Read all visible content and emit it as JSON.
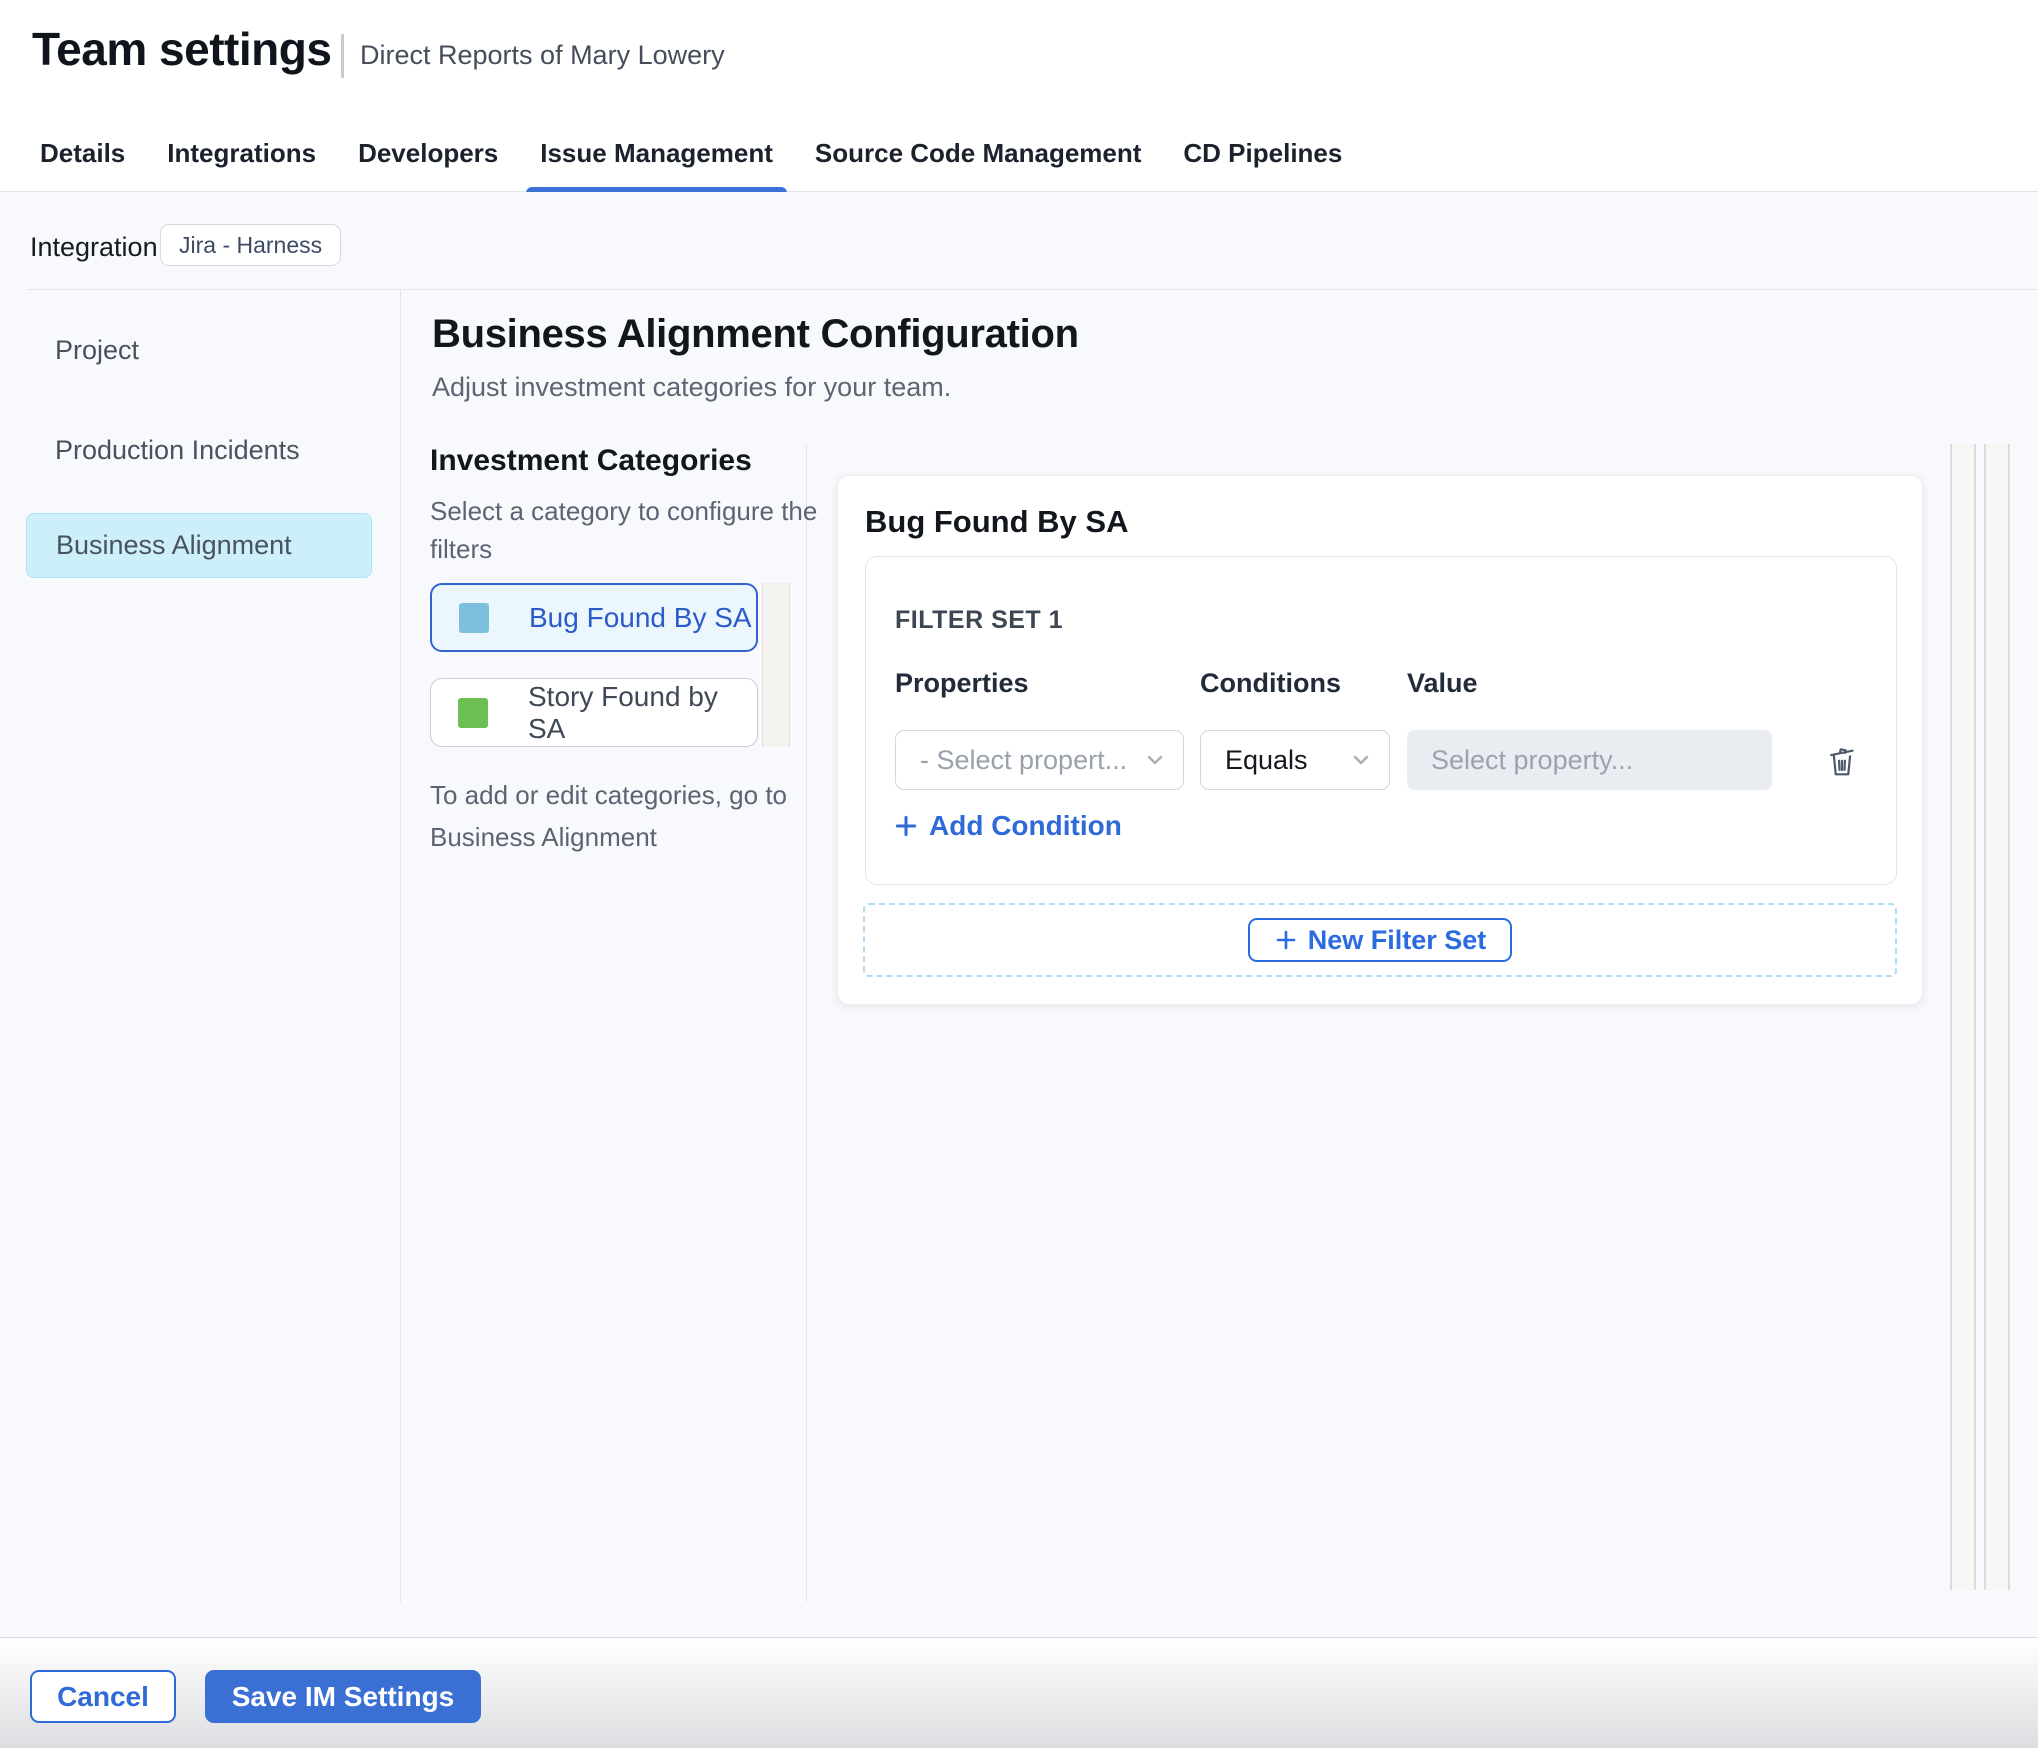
{
  "header": {
    "title": "Team settings",
    "subtitle": "Direct Reports of Mary Lowery"
  },
  "tabs": [
    {
      "label": "Details",
      "active": false
    },
    {
      "label": "Integrations",
      "active": false
    },
    {
      "label": "Developers",
      "active": false
    },
    {
      "label": "Issue Management",
      "active": true
    },
    {
      "label": "Source Code Management",
      "active": false
    },
    {
      "label": "CD Pipelines",
      "active": false
    }
  ],
  "integration": {
    "label": "Integration:",
    "chip": "Jira - Harness"
  },
  "sidebar": {
    "items": [
      {
        "label": "Project",
        "selected": false
      },
      {
        "label": "Production Incidents",
        "selected": false
      },
      {
        "label": "Business Alignment",
        "selected": true
      }
    ]
  },
  "main": {
    "title": "Business Alignment Configuration",
    "subtitle": "Adjust investment categories for your team.",
    "categories": {
      "title": "Investment Categories",
      "helper_line1": "Select a category to configure the",
      "helper_line2": "filters",
      "items": [
        {
          "label": "Bug Found By SA",
          "swatch_color": "#7cc0dd",
          "selected": true
        },
        {
          "label": "Story Found by SA",
          "swatch_color": "#6cc052",
          "selected": false
        }
      ],
      "note_line1": "To add or edit categories, go to",
      "note_line2": "Business Alignment"
    },
    "panel": {
      "title": "Bug Found By SA",
      "filter_set": {
        "title": "FILTER SET 1",
        "properties_label": "Properties",
        "conditions_label": "Conditions",
        "value_label": "Value",
        "property_selected": "- Select propert...",
        "condition_selected": "Equals",
        "value_placeholder": "Select property...",
        "add_condition_label": "Add Condition"
      },
      "new_filter_set_label": "New Filter Set"
    }
  },
  "footer": {
    "cancel_label": "Cancel",
    "save_label": "Save IM Settings"
  },
  "icons": {
    "select_chevron": "chevron-down-icon",
    "delete_condition": "trash-icon",
    "add": "plus-icon"
  },
  "colors": {
    "accent_blue": "#3b70d6",
    "link_blue": "#2e6bd8",
    "selected_category_bg": "#ecf7fd",
    "selected_sidebar_bg": "#cdeffa",
    "content_bg": "#f8f9fc",
    "input_bg": "#e9edf2",
    "bug_swatch": "#7cc0dd",
    "story_swatch": "#6cc052"
  }
}
